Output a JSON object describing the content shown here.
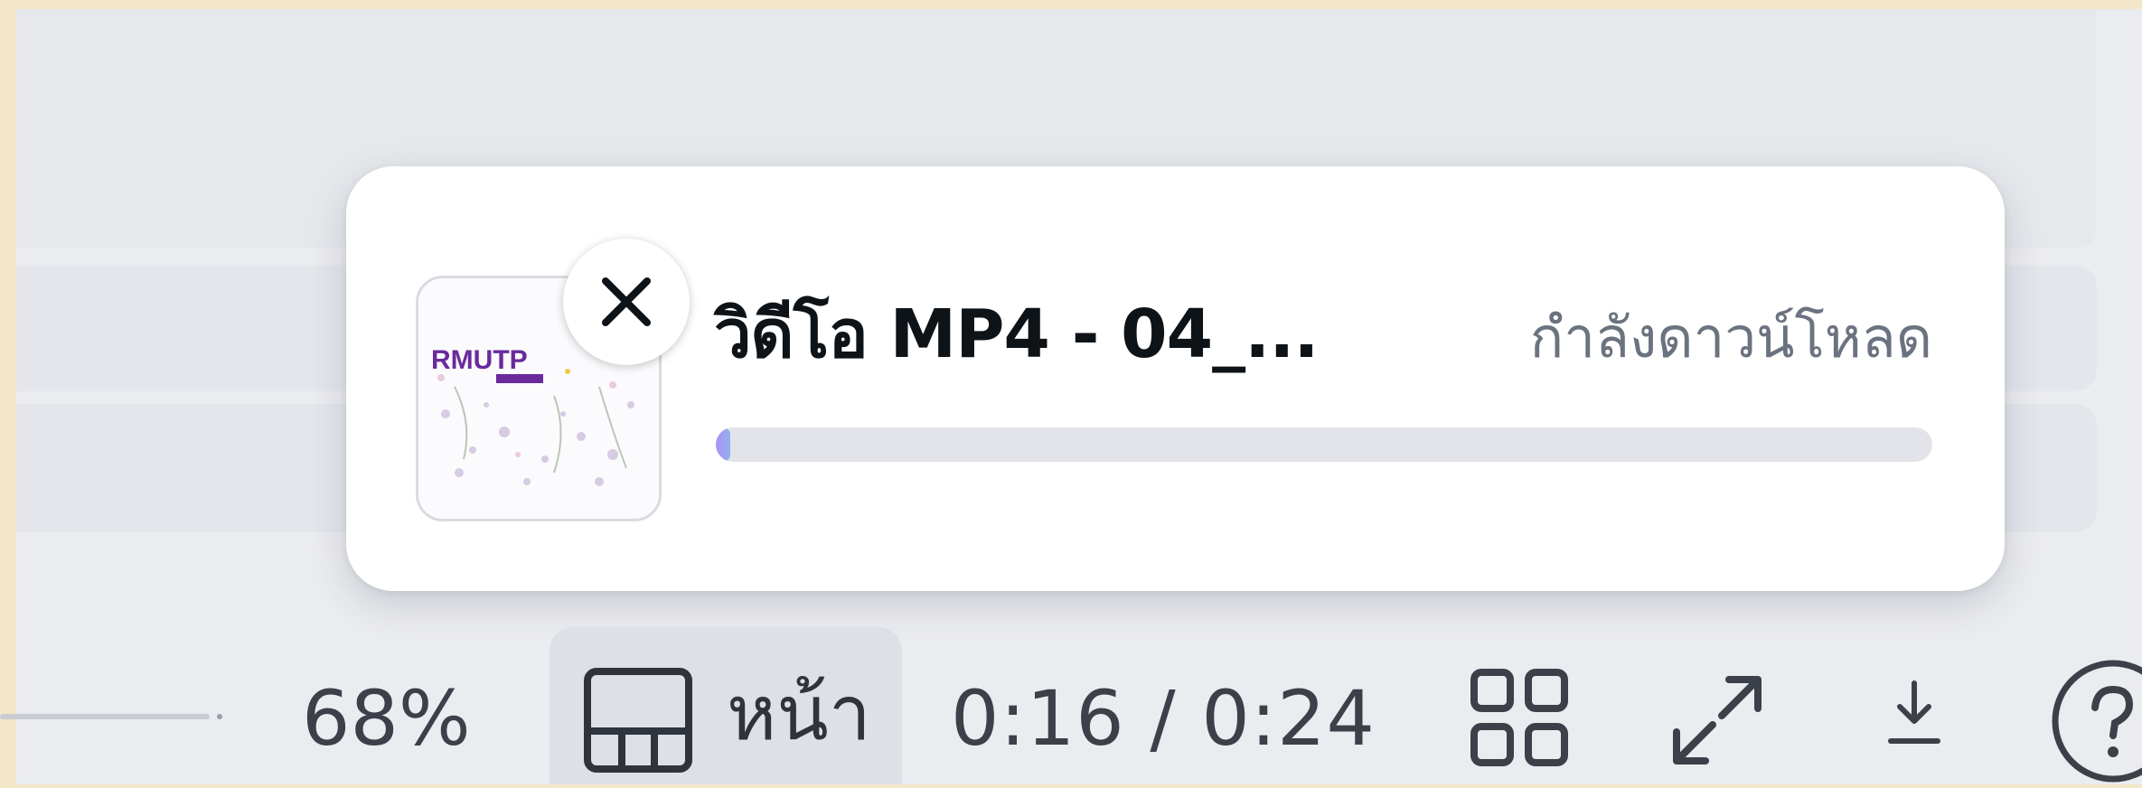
{
  "download": {
    "file_title": "วิดีโอ MP4 - 04_...",
    "status": "กำลังดาวน์โหลด",
    "progress": 0.01,
    "thumbnail_text": "RMUTP",
    "close_icon": "close-icon"
  },
  "toolbar": {
    "zoom": "68%",
    "page_label": "หน้า",
    "time": "0:16 / 0:24",
    "icons": [
      "pages-layout-icon",
      "grid-view-icon",
      "fullscreen-icon",
      "download-icon",
      "help-icon"
    ]
  },
  "colors": {
    "accent": "#8b3dff",
    "status_text": "#6b7280"
  }
}
